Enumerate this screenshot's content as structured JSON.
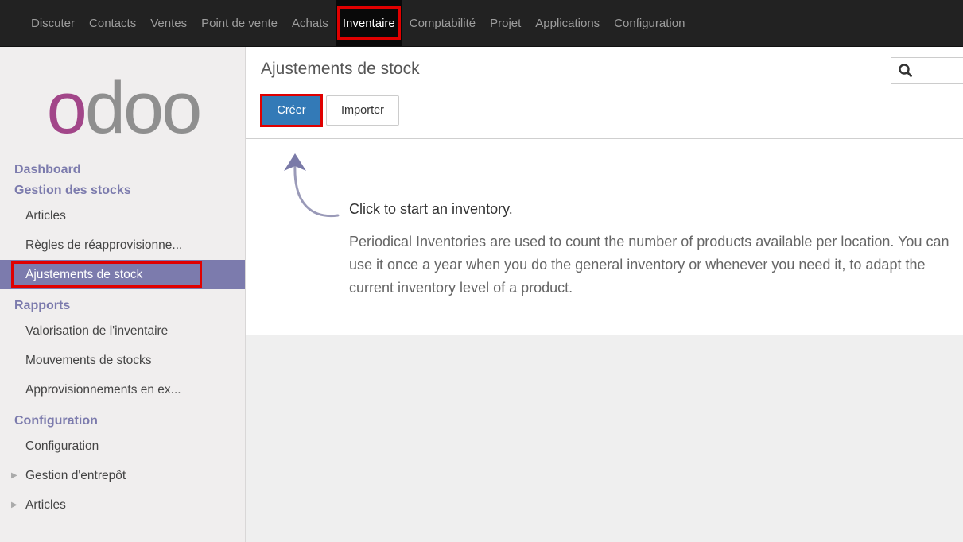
{
  "topbar": {
    "items": [
      "Discuter",
      "Contacts",
      "Ventes",
      "Point de vente",
      "Achats",
      "Inventaire",
      "Comptabilité",
      "Projet",
      "Applications",
      "Configuration"
    ],
    "active": "Inventaire"
  },
  "logo": {
    "text": "odoo"
  },
  "sidebar": {
    "sections": [
      {
        "title": "Dashboard"
      },
      {
        "title": "Gestion des stocks",
        "items": [
          "Articles",
          "Règles de réapprovisionne...",
          "Ajustements de stock"
        ]
      },
      {
        "title": "Rapports",
        "items": [
          "Valorisation de l'inventaire",
          "Mouvements de stocks",
          "Approvisionnements en ex..."
        ]
      },
      {
        "title": "Configuration",
        "items": [
          "Configuration",
          "Gestion d'entrepôt",
          "Articles"
        ]
      }
    ],
    "active_item": "Ajustements de stock"
  },
  "main": {
    "title": "Ajustements de stock",
    "create_label": "Créer",
    "import_label": "Importer",
    "helper_title": "Click to start an inventory.",
    "helper_body": "Periodical Inventories are used to count the number of products available per location. You can use it once a year when you do the general inventory or whenever you need it, to adapt the current inventory level of a product."
  },
  "colors": {
    "topbar_bg": "#222222",
    "brand_purple": "#7c7bad",
    "primary_blue": "#337ab7",
    "highlight_red": "#e00000"
  },
  "icons": {
    "search": "search-icon",
    "arrow": "curved-arrow-up-icon",
    "caret": "caret-right-icon"
  }
}
